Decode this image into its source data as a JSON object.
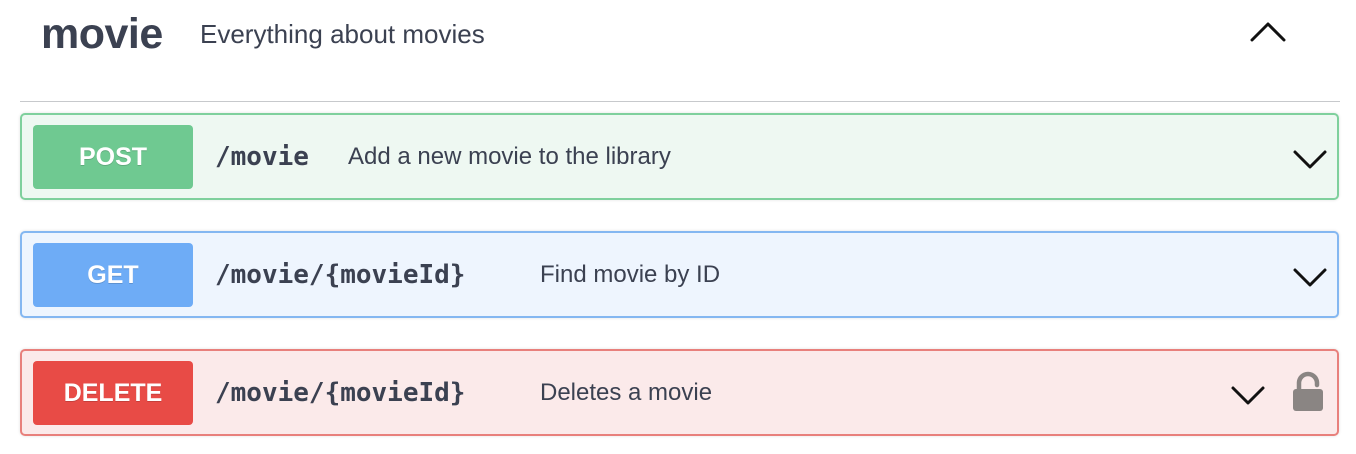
{
  "tag": {
    "name": "movie",
    "description": "Everything about movies",
    "toggle_icon": "chevron-up-icon"
  },
  "operations": [
    {
      "method": "POST",
      "path": "/movie",
      "summary": "Add a new movie to the library",
      "method_color": "#6fc991",
      "background_color": "#eef8f2",
      "border_color": "#7fd09d",
      "expand_icon": "chevron-down-icon"
    },
    {
      "method": "GET",
      "path": "/movie/{movieId}",
      "summary": "Find movie by ID",
      "method_color": "#6eacf6",
      "background_color": "#eef5fe",
      "border_color": "#84b7f1",
      "expand_icon": "chevron-down-icon"
    },
    {
      "method": "DELETE",
      "path": "/movie/{movieId}",
      "summary": "Deletes a movie",
      "method_color": "#e84b46",
      "background_color": "#fbeaea",
      "border_color": "#e8807c",
      "expand_icon": "chevron-down-icon",
      "auth_icon": "lock-icon"
    }
  ]
}
